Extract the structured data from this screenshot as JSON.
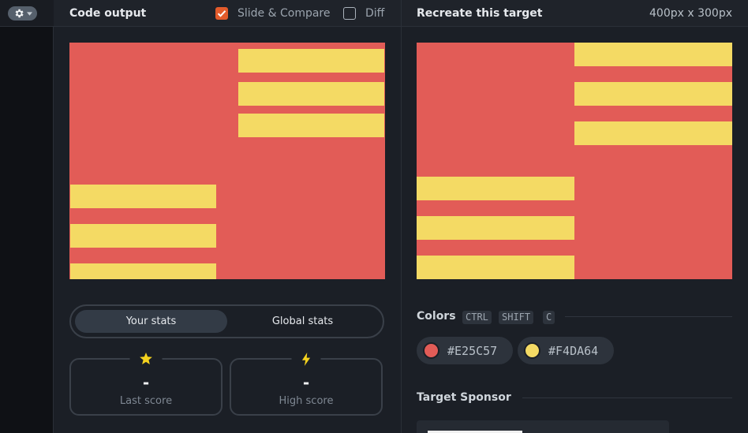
{
  "header": {
    "left_title": "Code output",
    "slide_compare_label": "Slide & Compare",
    "slide_compare_checked": true,
    "diff_label": "Diff",
    "diff_checked": false,
    "right_title": "Recreate this target",
    "dimensions": "400px x 300px"
  },
  "colors": {
    "red": "#E25C57",
    "yellow": "#F4DA64",
    "accent_check": "#E35B2B"
  },
  "stats": {
    "tabs": [
      "Your stats",
      "Global stats"
    ],
    "active_tab": "Your stats",
    "last_score": {
      "value": "-",
      "label": "Last score",
      "icon": "star-icon"
    },
    "high_score": {
      "value": "-",
      "label": "High score",
      "icon": "lightning-icon"
    }
  },
  "palette": {
    "title": "Colors",
    "shortcut": [
      "CTRL",
      "SHIFT",
      "C"
    ],
    "swatches": [
      {
        "hex": "#E25C57",
        "label": "#E25C57"
      },
      {
        "hex": "#F4DA64",
        "label": "#F4DA64"
      }
    ]
  },
  "sponsor": {
    "title": "Target Sponsor"
  }
}
